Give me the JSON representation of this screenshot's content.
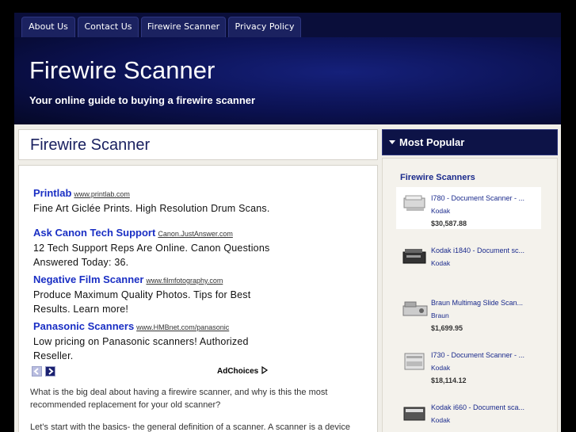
{
  "nav": {
    "items": [
      {
        "label": "About Us"
      },
      {
        "label": "Contact Us"
      },
      {
        "label": "Firewire Scanner"
      },
      {
        "label": "Privacy Policy"
      }
    ]
  },
  "header": {
    "title": "Firewire Scanner",
    "tagline": "Your online guide to buying a firewire scanner"
  },
  "post": {
    "title": "Firewire Scanner"
  },
  "ads": [
    {
      "title": "Printlab",
      "url": "www.printlab.com",
      "desc": "Fine Art Giclée Prints. High Resolution Drum Scans."
    },
    {
      "title": "Ask Canon Tech Support",
      "url": "Canon.JustAnswer.com",
      "desc": "12 Tech Support Reps Are Online. Canon Questions Answered Today: 36."
    },
    {
      "title": "Negative Film Scanner",
      "url": "www.filmfotography.com",
      "desc": "Produce Maximum Quality Photos. Tips for Best Results. Learn more!"
    },
    {
      "title": "Panasonic Scanners",
      "url": "www.HMBnet.com/panasonic",
      "desc": "Low pricing on Panasonic scanners! Authorized Reseller."
    }
  ],
  "adchoices": "AdChoices",
  "paragraphs": [
    "What is the big deal about having a firewire scanner, and why is this the most recommended replacement for your old scanner?",
    "Let’s start with the basics- the general definition of a scanner. A scanner is a device"
  ],
  "sidebar": {
    "heading": "Most Popular",
    "category": "Firewire Scanners",
    "products": [
      {
        "name": "I780 - Document Scanner - ...",
        "brand": "Kodak",
        "price": "$30,587.88"
      },
      {
        "name": "Kodak i1840 - Document sc...",
        "brand": "Kodak",
        "price": ""
      },
      {
        "name": "Braun Multimag Slide Scan...",
        "brand": "Braun",
        "price": "$1,699.95"
      },
      {
        "name": "I730 - Document Scanner - ...",
        "brand": "Kodak",
        "price": "$18,114.12"
      },
      {
        "name": "Kodak i660 - Document sca...",
        "brand": "Kodak",
        "price": ""
      }
    ]
  },
  "colors": {
    "nav_bg": "#0a0e3a",
    "tab_bg": "#1b2260",
    "header_blue": "#0b1150",
    "link_blue": "#1a2fc4",
    "sidebar_link": "#1a2a8c"
  }
}
